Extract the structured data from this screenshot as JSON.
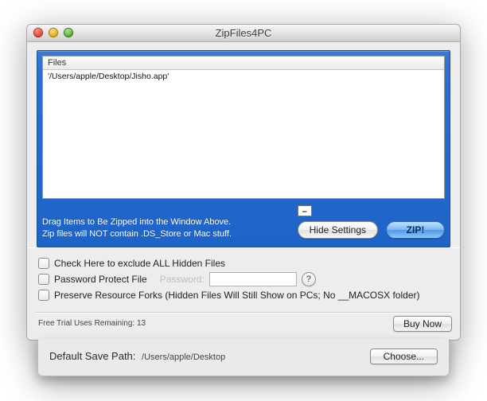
{
  "window": {
    "title": "ZipFiles4PC"
  },
  "files": {
    "header": "Files",
    "rows": [
      "'/Users/apple/Desktop/Jisho.app'"
    ]
  },
  "instructions": "Drag Items to Be Zipped into the Window Above.  Zip files will NOT contain .DS_Store or Mac stuff.",
  "buttons": {
    "hide_settings": "Hide Settings",
    "zip": "ZIP!",
    "buy_now": "Buy Now",
    "choose": "Choose...",
    "minimize_glyph": "–"
  },
  "settings": {
    "exclude_hidden": "Check Here to exclude ALL Hidden Files",
    "password_protect": "Password Protect File",
    "password_label": "Password:",
    "password_value": "",
    "preserve_forks": "Preserve Resource Forks (Hidden Files Will Still Show on PCs; No __MACOSX folder)",
    "help_glyph": "?"
  },
  "trial": {
    "label": "Free Trial Uses Remaining:",
    "count": "13"
  },
  "save_path": {
    "label": "Default Save Path:",
    "value": "/Users/apple/Desktop"
  }
}
